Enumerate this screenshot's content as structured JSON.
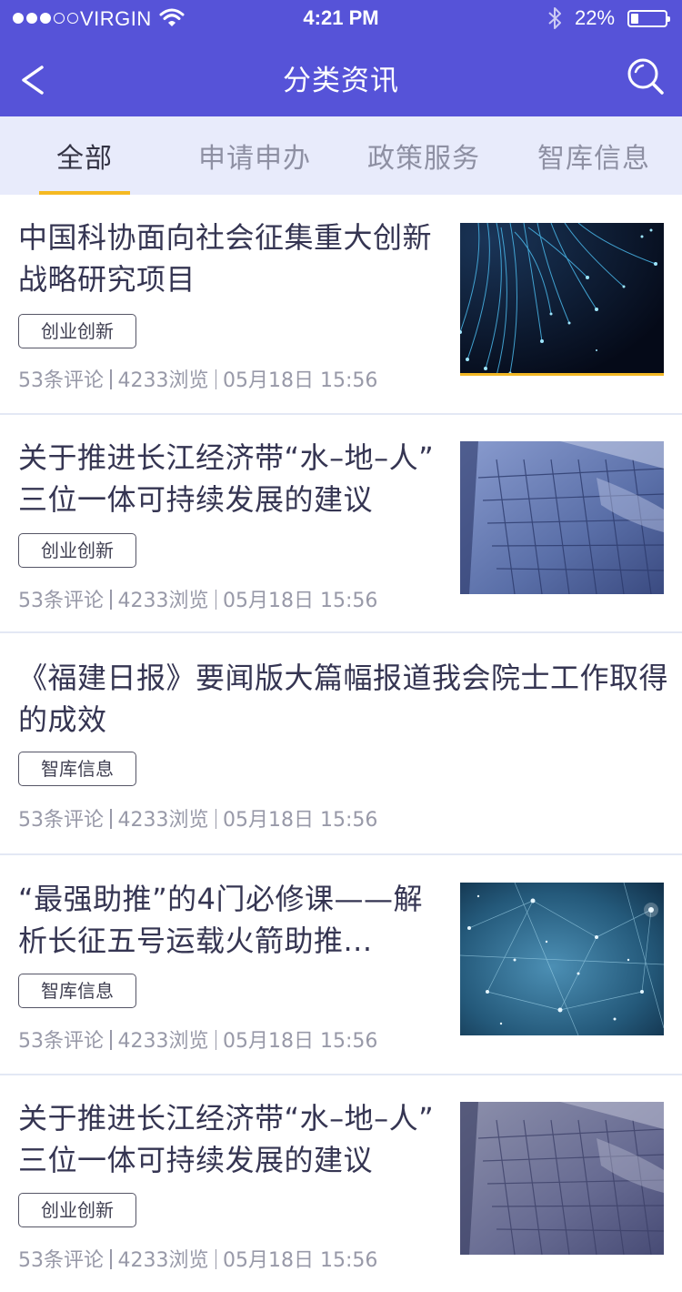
{
  "status_bar": {
    "carrier": "VIRGIN",
    "time": "4:21 PM",
    "battery": "22%",
    "battery_level": 0.22,
    "signal_bars": 3,
    "signal_total": 5
  },
  "nav": {
    "title": "分类资讯",
    "back_icon": "chevron-left-icon",
    "search_icon": "search-icon"
  },
  "tabs": [
    {
      "label": "全部",
      "active": true
    },
    {
      "label": "申请申办",
      "active": false
    },
    {
      "label": "政策服务",
      "active": false
    },
    {
      "label": "智库信息",
      "active": false
    }
  ],
  "colors": {
    "header_bg": "#5653d8",
    "tab_bg": "#e8ebfb",
    "tab_indicator": "#f5b922",
    "title_text": "#353552",
    "meta_text": "#9899a8"
  },
  "articles": [
    {
      "title_line1": "中国科协面向社会征集重大创新",
      "title_line2": "战略研究项目",
      "tag": "创业创新",
      "comments": "53条评论",
      "views": "4233浏览",
      "date": "05月18日 15:56",
      "image": "fiber-optic-lights"
    },
    {
      "title_line1": "关于推进长江经济带“水–地–人”",
      "title_line2": "三位一体可持续发展的建议",
      "tag": "创业创新",
      "comments": "53条评论",
      "views": "4233浏览",
      "date": "05月18日 15:56",
      "image": "keyboard-typing"
    },
    {
      "title_line1": "《福建日报》要闻版大篇幅报道我会院士工作取得",
      "title_line2": "的成效",
      "tag": "智库信息",
      "comments": "53条评论",
      "views": "4233浏览",
      "date": "05月18日 15:56",
      "image": ""
    },
    {
      "title_line1": "“最强助推”的4门必修课——解",
      "title_line2": "析长征五号运载火箭助推...",
      "tag": "智库信息",
      "comments": "53条评论",
      "views": "4233浏览",
      "date": "05月18日 15:56",
      "image": "network-particles"
    },
    {
      "title_line1": "关于推进长江经济带“水–地–人”",
      "title_line2": "三位一体可持续发展的建议",
      "tag": "创业创新",
      "comments": "53条评论",
      "views": "4233浏览",
      "date": "05月18日 15:56",
      "image": "keyboard-typing"
    }
  ]
}
